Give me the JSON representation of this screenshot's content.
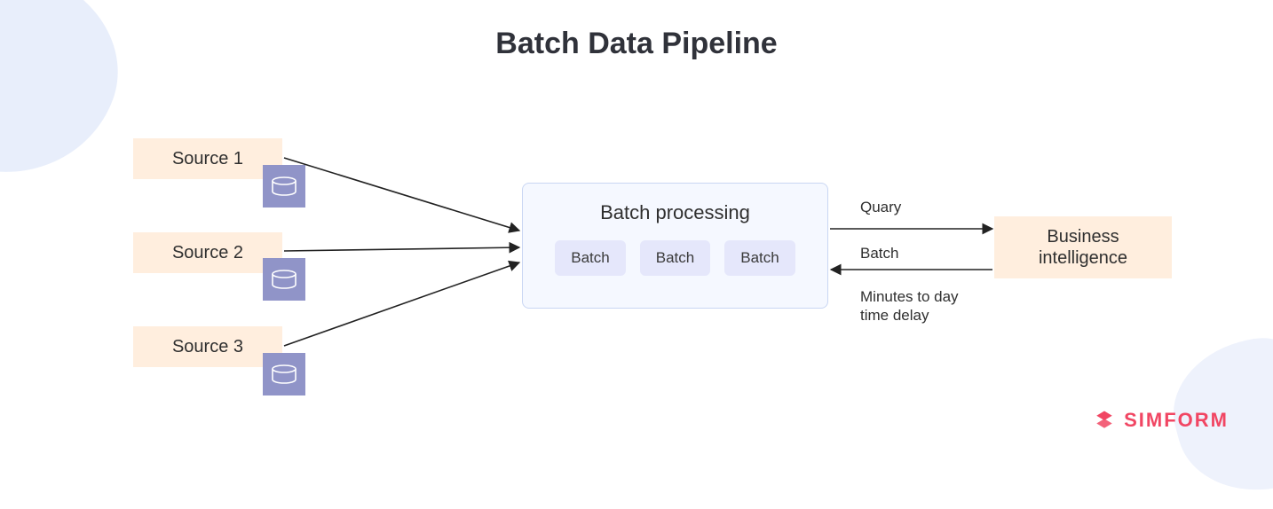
{
  "title": "Batch Data Pipeline",
  "sources": {
    "items": [
      {
        "label": "Source 1"
      },
      {
        "label": "Source 2"
      },
      {
        "label": "Source  3"
      }
    ]
  },
  "processing": {
    "title": "Batch processing",
    "batches": [
      "Batch",
      "Batch",
      "Batch"
    ]
  },
  "annotations": {
    "query": "Quary",
    "batch_response": "Batch",
    "delay_line1": "Minutes to day",
    "delay_line2": "time delay"
  },
  "output": {
    "line1": "Business",
    "line2": "intelligence"
  },
  "brand": {
    "name": "SIMFORM",
    "color": "#f14663"
  },
  "colors": {
    "source_bg": "#ffeede",
    "db_tile": "#9094c8",
    "processing_bg": "#f5f8ff",
    "batch_bg": "#e5e7fb",
    "arrow": "#222222"
  }
}
